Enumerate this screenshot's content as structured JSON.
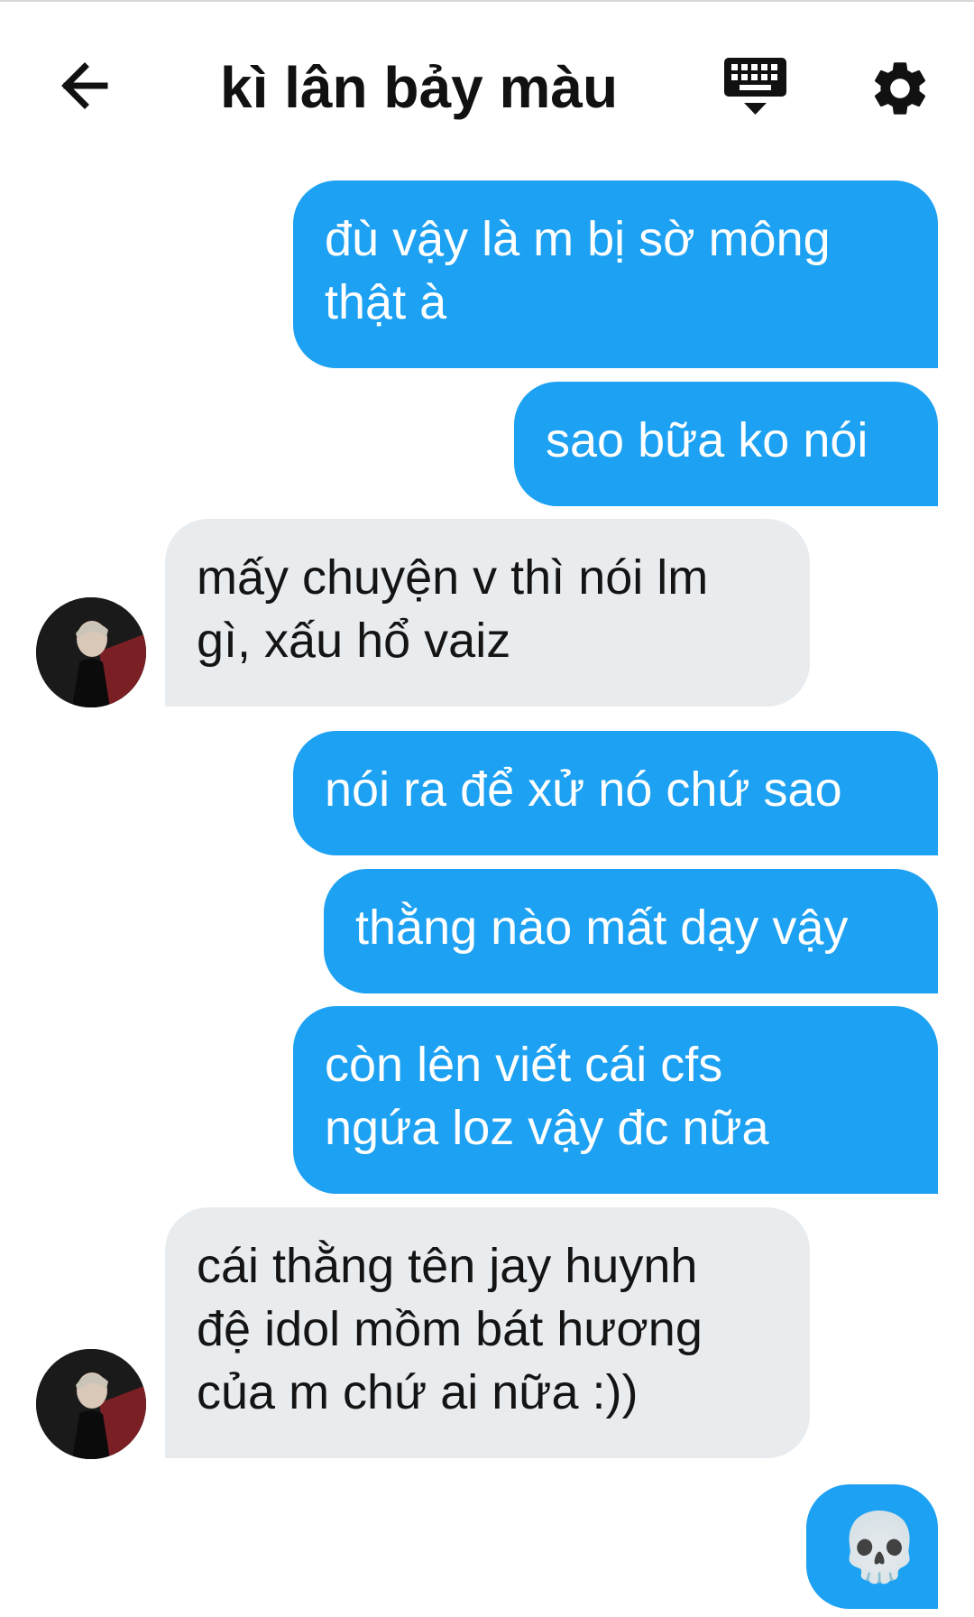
{
  "header": {
    "title": "kì lân bảy màu",
    "back_icon": "arrow-left-icon",
    "keyboard_icon": "keyboard-icon",
    "settings_icon": "gear-icon"
  },
  "colors": {
    "outgoing_bubble": "#1da1f2",
    "incoming_bubble": "#e8ecef",
    "text_dark": "#141414",
    "text_light": "#ffffff"
  },
  "messages": [
    {
      "direction": "outgoing",
      "text": "đù vậy là m bị sờ mông\nthật à"
    },
    {
      "direction": "outgoing",
      "text": "sao bữa ko nói"
    },
    {
      "direction": "incoming",
      "text": "mấy chuyện v thì nói lm\ngì, xấu hổ vaiz"
    },
    {
      "direction": "outgoing",
      "text": "nói ra để xử nó chứ sao"
    },
    {
      "direction": "outgoing",
      "text": "thằng nào mất dạy vậy"
    },
    {
      "direction": "outgoing",
      "text": "còn lên viết cái cfs\nngứa loz vậy đc nữa"
    },
    {
      "direction": "incoming",
      "text": "cái thằng tên jay huynh\nđệ idol mồm bát hương\ncủa m chứ ai nữa :))"
    },
    {
      "direction": "outgoing",
      "text": "💀"
    }
  ]
}
